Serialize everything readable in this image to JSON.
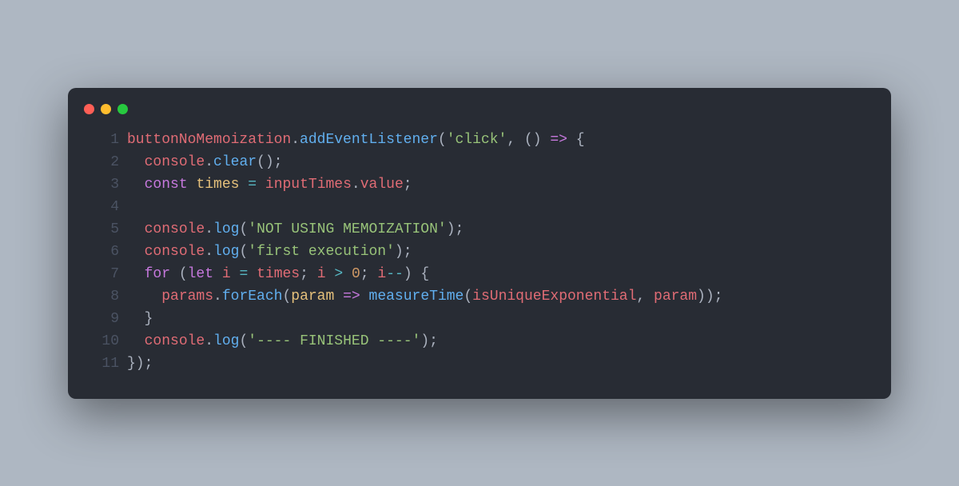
{
  "window": {
    "dots": [
      "red",
      "yellow",
      "green"
    ]
  },
  "code": {
    "lines": [
      {
        "n": "1",
        "tokens": [
          {
            "cls": "tok-ident",
            "t": "buttonNoMemoization"
          },
          {
            "cls": "tok-punc",
            "t": "."
          },
          {
            "cls": "tok-method",
            "t": "addEventListener"
          },
          {
            "cls": "tok-punc",
            "t": "("
          },
          {
            "cls": "tok-string",
            "t": "'click'"
          },
          {
            "cls": "tok-punc",
            "t": ", () "
          },
          {
            "cls": "tok-arrow",
            "t": "=>"
          },
          {
            "cls": "tok-punc",
            "t": " {"
          }
        ]
      },
      {
        "n": "2",
        "tokens": [
          {
            "cls": "tok-punc",
            "t": "  "
          },
          {
            "cls": "tok-ident",
            "t": "console"
          },
          {
            "cls": "tok-punc",
            "t": "."
          },
          {
            "cls": "tok-method",
            "t": "clear"
          },
          {
            "cls": "tok-punc",
            "t": "();"
          }
        ]
      },
      {
        "n": "3",
        "tokens": [
          {
            "cls": "tok-punc",
            "t": "  "
          },
          {
            "cls": "tok-decl",
            "t": "const"
          },
          {
            "cls": "tok-punc",
            "t": " "
          },
          {
            "cls": "tok-param",
            "t": "times"
          },
          {
            "cls": "tok-punc",
            "t": " "
          },
          {
            "cls": "tok-op",
            "t": "="
          },
          {
            "cls": "tok-punc",
            "t": " "
          },
          {
            "cls": "tok-ident",
            "t": "inputTimes"
          },
          {
            "cls": "tok-punc",
            "t": "."
          },
          {
            "cls": "tok-ident",
            "t": "value"
          },
          {
            "cls": "tok-punc",
            "t": ";"
          }
        ]
      },
      {
        "n": "4",
        "tokens": [
          {
            "cls": "tok-punc",
            "t": ""
          }
        ]
      },
      {
        "n": "5",
        "tokens": [
          {
            "cls": "tok-punc",
            "t": "  "
          },
          {
            "cls": "tok-ident",
            "t": "console"
          },
          {
            "cls": "tok-punc",
            "t": "."
          },
          {
            "cls": "tok-method",
            "t": "log"
          },
          {
            "cls": "tok-punc",
            "t": "("
          },
          {
            "cls": "tok-string",
            "t": "'NOT USING MEMOIZATION'"
          },
          {
            "cls": "tok-punc",
            "t": ");"
          }
        ]
      },
      {
        "n": "6",
        "tokens": [
          {
            "cls": "tok-punc",
            "t": "  "
          },
          {
            "cls": "tok-ident",
            "t": "console"
          },
          {
            "cls": "tok-punc",
            "t": "."
          },
          {
            "cls": "tok-method",
            "t": "log"
          },
          {
            "cls": "tok-punc",
            "t": "("
          },
          {
            "cls": "tok-string",
            "t": "'first execution'"
          },
          {
            "cls": "tok-punc",
            "t": ");"
          }
        ]
      },
      {
        "n": "7",
        "tokens": [
          {
            "cls": "tok-punc",
            "t": "  "
          },
          {
            "cls": "tok-keyword",
            "t": "for"
          },
          {
            "cls": "tok-punc",
            "t": " ("
          },
          {
            "cls": "tok-decl",
            "t": "let"
          },
          {
            "cls": "tok-punc",
            "t": " "
          },
          {
            "cls": "tok-ident",
            "t": "i"
          },
          {
            "cls": "tok-punc",
            "t": " "
          },
          {
            "cls": "tok-op",
            "t": "="
          },
          {
            "cls": "tok-punc",
            "t": " "
          },
          {
            "cls": "tok-ident",
            "t": "times"
          },
          {
            "cls": "tok-punc",
            "t": "; "
          },
          {
            "cls": "tok-ident",
            "t": "i"
          },
          {
            "cls": "tok-punc",
            "t": " "
          },
          {
            "cls": "tok-op",
            "t": ">"
          },
          {
            "cls": "tok-punc",
            "t": " "
          },
          {
            "cls": "tok-number",
            "t": "0"
          },
          {
            "cls": "tok-punc",
            "t": "; "
          },
          {
            "cls": "tok-ident",
            "t": "i"
          },
          {
            "cls": "tok-op",
            "t": "--"
          },
          {
            "cls": "tok-punc",
            "t": ") {"
          }
        ]
      },
      {
        "n": "8",
        "tokens": [
          {
            "cls": "tok-punc",
            "t": "    "
          },
          {
            "cls": "tok-ident",
            "t": "params"
          },
          {
            "cls": "tok-punc",
            "t": "."
          },
          {
            "cls": "tok-method",
            "t": "forEach"
          },
          {
            "cls": "tok-punc",
            "t": "("
          },
          {
            "cls": "tok-param",
            "t": "param"
          },
          {
            "cls": "tok-punc",
            "t": " "
          },
          {
            "cls": "tok-arrow",
            "t": "=>"
          },
          {
            "cls": "tok-punc",
            "t": " "
          },
          {
            "cls": "tok-func",
            "t": "measureTime"
          },
          {
            "cls": "tok-punc",
            "t": "("
          },
          {
            "cls": "tok-ident",
            "t": "isUniqueExponential"
          },
          {
            "cls": "tok-punc",
            "t": ", "
          },
          {
            "cls": "tok-ident",
            "t": "param"
          },
          {
            "cls": "tok-punc",
            "t": "));"
          }
        ]
      },
      {
        "n": "9",
        "tokens": [
          {
            "cls": "tok-punc",
            "t": "  }"
          }
        ]
      },
      {
        "n": "10",
        "tokens": [
          {
            "cls": "tok-punc",
            "t": "  "
          },
          {
            "cls": "tok-ident",
            "t": "console"
          },
          {
            "cls": "tok-punc",
            "t": "."
          },
          {
            "cls": "tok-method",
            "t": "log"
          },
          {
            "cls": "tok-punc",
            "t": "("
          },
          {
            "cls": "tok-string",
            "t": "'---- FINISHED ----'"
          },
          {
            "cls": "tok-punc",
            "t": ");"
          }
        ]
      },
      {
        "n": "11",
        "tokens": [
          {
            "cls": "tok-punc",
            "t": "});"
          }
        ]
      }
    ]
  }
}
